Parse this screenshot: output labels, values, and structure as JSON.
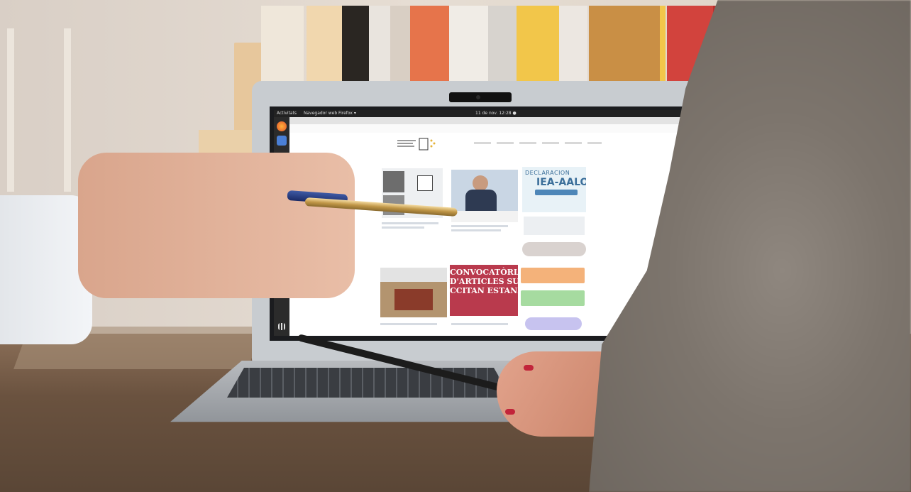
{
  "screen": {
    "topbar": {
      "activities": "Activitats",
      "app_name": "Navegador web Firefox ▾",
      "clock": "11 de nov.  12:28 ●"
    },
    "content": {
      "declaration_title_small": "DECLARACION",
      "declaration_title": "IEA-AALO",
      "poster_lines": [
        "CONVOCATÒRIA",
        "D'ARTICLES SUS EI",
        "CCITAN ESTANDAR"
      ]
    }
  },
  "icons": {
    "dock": [
      "firefox-icon",
      "files-icon",
      "app-icon",
      "app-grid-icon"
    ]
  },
  "colors": {
    "poster": "#b93a4d",
    "pill_gray": "#d9d2cf",
    "pill_orange": "#f4b27a",
    "pill_green": "#a6dba0",
    "pill_purple": "#c7c3ef",
    "declaration": "#3c6f9a"
  }
}
